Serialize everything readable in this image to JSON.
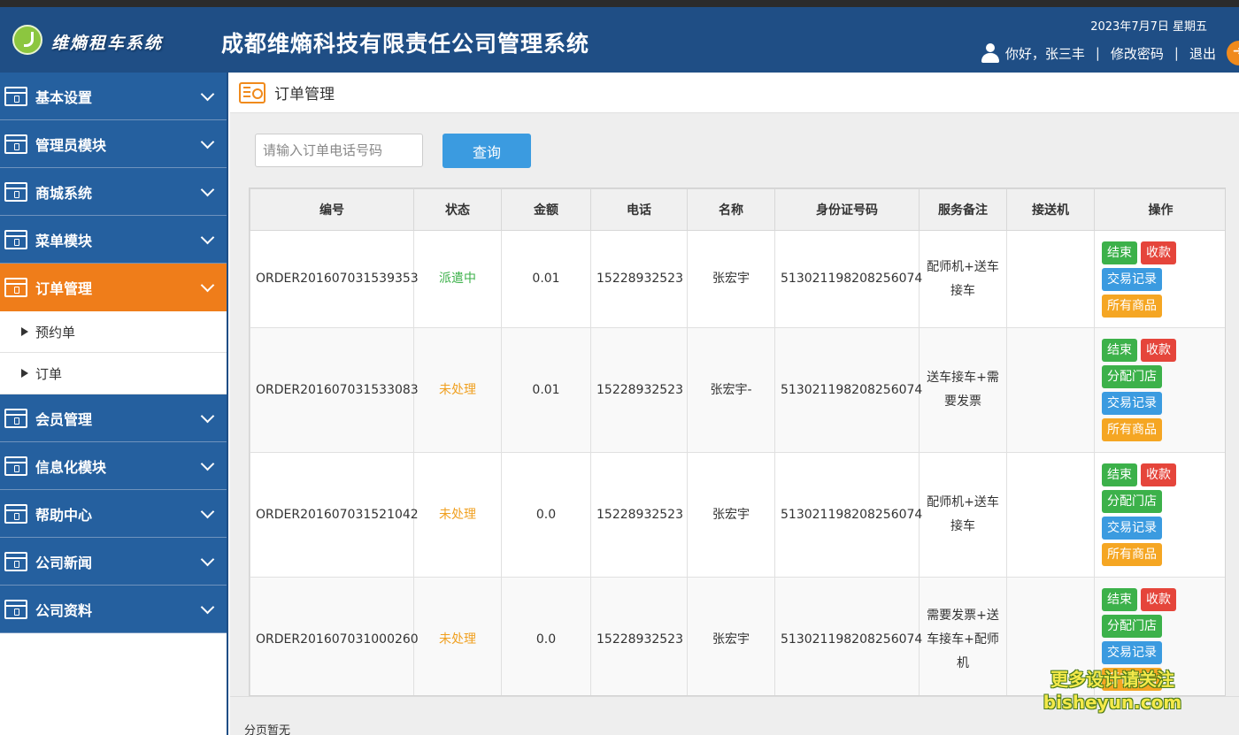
{
  "header": {
    "logo_text": "维熵租车系统",
    "system_title": "成都维熵科技有限责任公司管理系统",
    "date": "2023年7月7日 星期五",
    "greeting": "你好，张三丰",
    "sep1": "|",
    "change_password": "修改密码",
    "sep2": "|",
    "logout": "退出"
  },
  "sidebar": {
    "items": [
      {
        "label": "基本设置"
      },
      {
        "label": "管理员模块"
      },
      {
        "label": "商城系统"
      },
      {
        "label": "菜单模块"
      },
      {
        "label": "订单管理"
      },
      {
        "label": "会员管理"
      },
      {
        "label": "信息化模块"
      },
      {
        "label": "帮助中心"
      },
      {
        "label": "公司新闻"
      },
      {
        "label": "公司资料"
      }
    ],
    "sub_items": [
      {
        "label": "预约单"
      },
      {
        "label": "订单"
      }
    ]
  },
  "page": {
    "title": "订单管理",
    "search_placeholder": "请输入订单电话号码",
    "search_button": "查询",
    "pager_text": "分页暂无"
  },
  "table": {
    "headers": [
      "编号",
      "状态",
      "金额",
      "电话",
      "名称",
      "身份证号码",
      "服务备注",
      "接送机",
      "操作"
    ],
    "rows": [
      {
        "id": "ORDER201607031539353",
        "status": "派遣中",
        "amount": "0.01",
        "phone": "15228932523",
        "name": "张宏宇",
        "idcard": "513021198208256074",
        "note": "配师机+送车接车",
        "pickup": ""
      },
      {
        "id": "ORDER201607031533083",
        "status": "未处理",
        "amount": "0.01",
        "phone": "15228932523",
        "name": "张宏宇-",
        "idcard": "513021198208256074",
        "note": "送车接车+需要发票",
        "pickup": ""
      },
      {
        "id": "ORDER201607031521042",
        "status": "未处理",
        "amount": "0.0",
        "phone": "15228932523",
        "name": "张宏宇",
        "idcard": "513021198208256074",
        "note": "配师机+送车接车",
        "pickup": ""
      },
      {
        "id": "ORDER201607031000260",
        "status": "未处理",
        "amount": "0.0",
        "phone": "15228932523",
        "name": "张宏宇",
        "idcard": "513021198208256074",
        "note": "需要发票+送车接车+配师机",
        "pickup": ""
      }
    ],
    "actions": {
      "finish": "结束",
      "collect": "收款",
      "assign_store": "分配门店",
      "transactions": "交易记录",
      "all_goods": "所有商品"
    }
  },
  "watermark": {
    "line1": "更多设计请关注",
    "line2": "bisheyun.com"
  },
  "colors": {
    "header_bg": "#1f4e85",
    "menu_bg": "#25609f",
    "menu_active": "#ef7d1a",
    "btn_green": "#3cb14a",
    "btn_red": "#e5453b",
    "btn_blue": "#3b9be0",
    "btn_orange": "#f5a623"
  }
}
